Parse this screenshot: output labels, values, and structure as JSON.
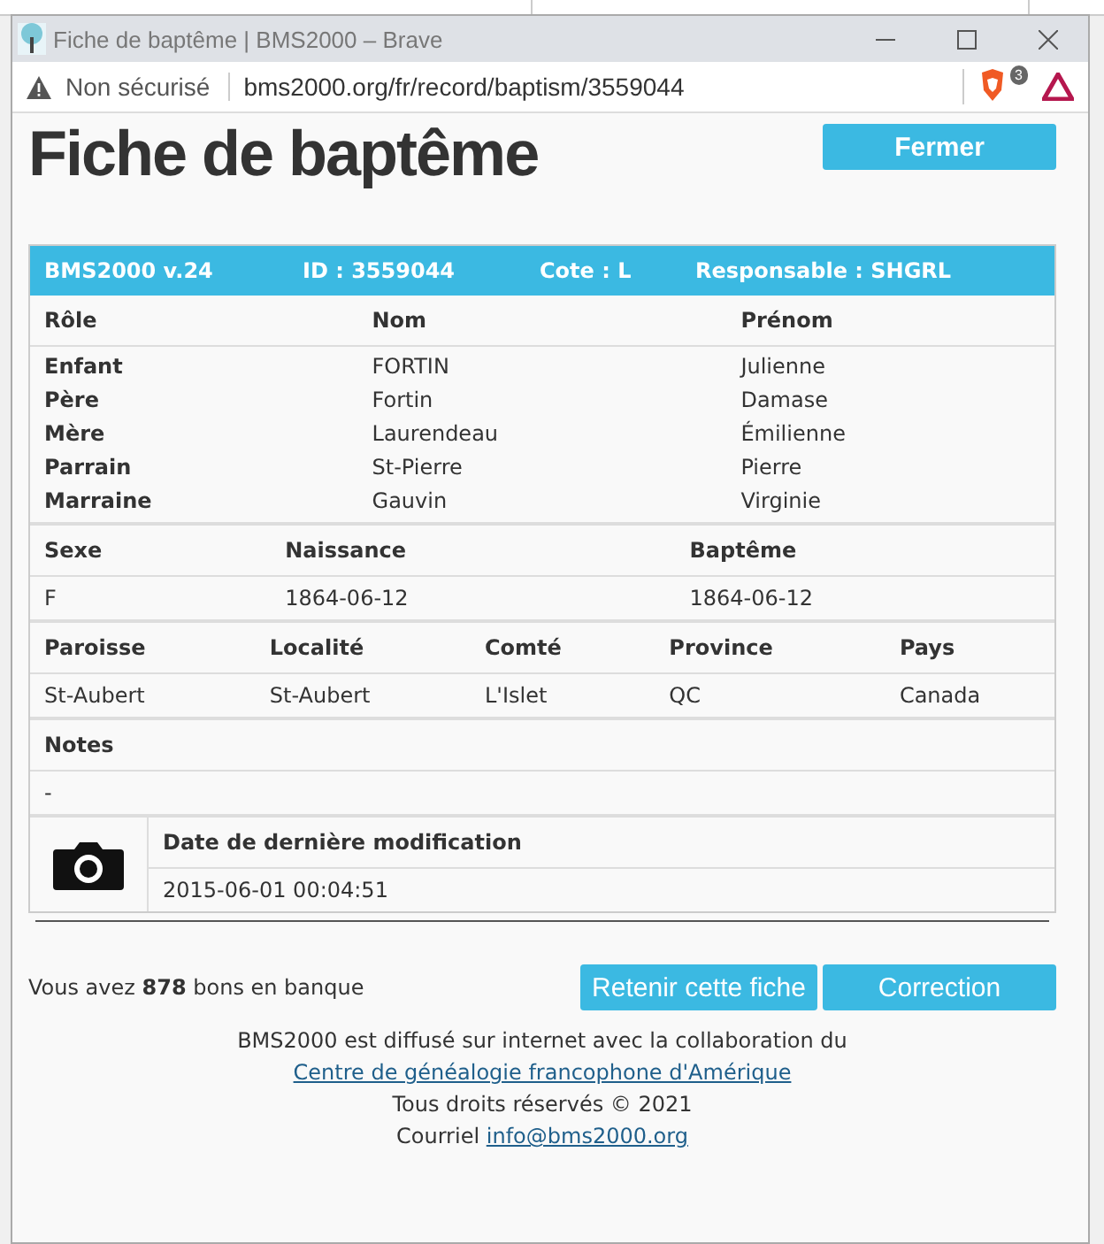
{
  "window": {
    "title": "Fiche de baptême | BMS2000 – Brave"
  },
  "address_bar": {
    "security": "Non sécurisé",
    "url": "bms2000.org/fr/record/baptism/3559044",
    "shield_count": "3"
  },
  "page": {
    "heading": "Fiche de baptême",
    "close_button": "Fermer"
  },
  "record_header": [
    "BMS2000 v.24",
    "ID : 3559044",
    "Cote : L",
    "Responsable : SHGRL"
  ],
  "persons": {
    "columns": [
      "Rôle",
      "Nom",
      "Prénom"
    ],
    "rows": [
      [
        "Enfant",
        "FORTIN",
        "Julienne"
      ],
      [
        "Père",
        "Fortin",
        "Damase"
      ],
      [
        "Mère",
        "Laurendeau",
        "Émilienne"
      ],
      [
        "Parrain",
        "St-Pierre",
        "Pierre"
      ],
      [
        "Marraine",
        "Gauvin",
        "Virginie"
      ]
    ]
  },
  "dates": {
    "columns": [
      "Sexe",
      "Naissance",
      "Baptême"
    ],
    "values": [
      "F",
      "1864-06-12",
      "1864-06-12"
    ]
  },
  "location": {
    "columns": [
      "Paroisse",
      "Localité",
      "Comté",
      "Province",
      "Pays"
    ],
    "values": [
      "St-Aubert",
      "St-Aubert",
      "L'Islet",
      "QC",
      "Canada"
    ]
  },
  "notes": {
    "label": "Notes",
    "value": "-"
  },
  "modification": {
    "label": "Date de dernière modification",
    "value": "2015-06-01 00:04:51"
  },
  "bank_text": "Vous avez **878** bons en banque",
  "buttons": [
    "Retenir cette fiche",
    "Correction"
  ],
  "footer": {
    "line": "BMS2000 est diffusé sur internet avec la collaboration du",
    "link": "Centre de généalogie francophone d'Amérique",
    "rights": "Tous droits réservés © 2021",
    "email_label": "Courriel",
    "email": "info@bms2000.org"
  }
}
